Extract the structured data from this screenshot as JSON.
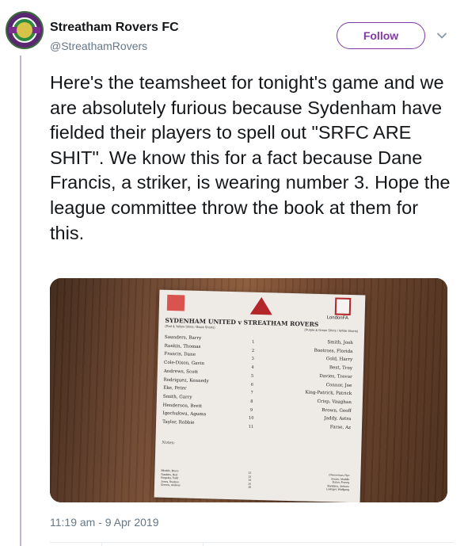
{
  "tweet": {
    "display_name": "Streatham Rovers FC",
    "handle": "@StreathamRovers",
    "follow_label": "Follow",
    "text": "Here's the teamsheet for tonight's game and we are absolutely furious because Sydenham have fielded their players to spell out \"SRFC ARE SHIT\". We know this for a fact because Dane Francis, a striker, is wearing number 3. Hope the league committee throw the book at them for this.",
    "timestamp": "11:19 am - 9 Apr 2019"
  },
  "icons": {
    "avatar": "club-crest-avatar",
    "menu": "chevron-down-icon"
  },
  "colors": {
    "accent": "#7f3aa3",
    "thread_line": "#c4b4d4",
    "muted_text": "#657786"
  },
  "teamsheet": {
    "fa_tag": "LondonFA",
    "fixture": "SYDENHAM UNITED v STREATHAM ROVERS",
    "home_kit": "(Red & Yellow Shirts / Black Shorts)",
    "away_kit": "(Purple & Green Shirts / White Shorts)",
    "home_players": [
      "Saunders, Barry",
      "Rankin, Thomas",
      "Francis, Dane",
      "Cole-Dixon, Gavin",
      "Andrews, Scott",
      "Rodriguez, Kennedy",
      "Eke, Peter",
      "Smith, Garry",
      "Henderson, Brett",
      "Igochukwu, Aguma",
      "Taylor, Robbie"
    ],
    "numbers": [
      "1",
      "2",
      "3",
      "4",
      "5",
      "6",
      "7",
      "8",
      "9",
      "10",
      "11"
    ],
    "away_players": [
      "Smith, Josh",
      "Bootross, Florida",
      "Gold, Harry",
      "Best, Troy",
      "Davies, Trevor",
      "Connor, Joe",
      "King-Patrick, Patrick",
      "Crisp, Vaughan",
      "Brown, Geoff",
      "Jaddy, Astra",
      "Farse, Az"
    ],
    "notes_label": "Notes:",
    "sub_home": [
      "Blooble, Bruce",
      "Sawkins, Red",
      "Kingsley, Todd",
      "Jones, Reuben",
      "Greene, Andrew"
    ],
    "sub_numbers": [
      "12",
      "13",
      "14",
      "15",
      "16"
    ],
    "sub_away": [
      "Cheeseman, Ryo",
      "Goose, Maddie",
      "Eaton, Franny",
      "Bandana, Jerkone",
      "LeAnger, Wolfgang"
    ]
  }
}
